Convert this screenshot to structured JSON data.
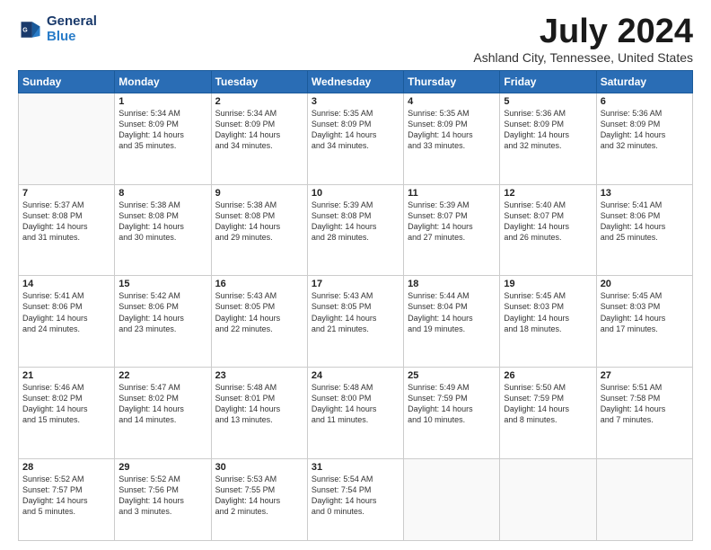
{
  "logo": {
    "line1": "General",
    "line2": "Blue"
  },
  "title": "July 2024",
  "subtitle": "Ashland City, Tennessee, United States",
  "days_of_week": [
    "Sunday",
    "Monday",
    "Tuesday",
    "Wednesday",
    "Thursday",
    "Friday",
    "Saturday"
  ],
  "weeks": [
    [
      {
        "num": "",
        "info": ""
      },
      {
        "num": "1",
        "info": "Sunrise: 5:34 AM\nSunset: 8:09 PM\nDaylight: 14 hours\nand 35 minutes."
      },
      {
        "num": "2",
        "info": "Sunrise: 5:34 AM\nSunset: 8:09 PM\nDaylight: 14 hours\nand 34 minutes."
      },
      {
        "num": "3",
        "info": "Sunrise: 5:35 AM\nSunset: 8:09 PM\nDaylight: 14 hours\nand 34 minutes."
      },
      {
        "num": "4",
        "info": "Sunrise: 5:35 AM\nSunset: 8:09 PM\nDaylight: 14 hours\nand 33 minutes."
      },
      {
        "num": "5",
        "info": "Sunrise: 5:36 AM\nSunset: 8:09 PM\nDaylight: 14 hours\nand 32 minutes."
      },
      {
        "num": "6",
        "info": "Sunrise: 5:36 AM\nSunset: 8:09 PM\nDaylight: 14 hours\nand 32 minutes."
      }
    ],
    [
      {
        "num": "7",
        "info": "Sunrise: 5:37 AM\nSunset: 8:08 PM\nDaylight: 14 hours\nand 31 minutes."
      },
      {
        "num": "8",
        "info": "Sunrise: 5:38 AM\nSunset: 8:08 PM\nDaylight: 14 hours\nand 30 minutes."
      },
      {
        "num": "9",
        "info": "Sunrise: 5:38 AM\nSunset: 8:08 PM\nDaylight: 14 hours\nand 29 minutes."
      },
      {
        "num": "10",
        "info": "Sunrise: 5:39 AM\nSunset: 8:08 PM\nDaylight: 14 hours\nand 28 minutes."
      },
      {
        "num": "11",
        "info": "Sunrise: 5:39 AM\nSunset: 8:07 PM\nDaylight: 14 hours\nand 27 minutes."
      },
      {
        "num": "12",
        "info": "Sunrise: 5:40 AM\nSunset: 8:07 PM\nDaylight: 14 hours\nand 26 minutes."
      },
      {
        "num": "13",
        "info": "Sunrise: 5:41 AM\nSunset: 8:06 PM\nDaylight: 14 hours\nand 25 minutes."
      }
    ],
    [
      {
        "num": "14",
        "info": "Sunrise: 5:41 AM\nSunset: 8:06 PM\nDaylight: 14 hours\nand 24 minutes."
      },
      {
        "num": "15",
        "info": "Sunrise: 5:42 AM\nSunset: 8:06 PM\nDaylight: 14 hours\nand 23 minutes."
      },
      {
        "num": "16",
        "info": "Sunrise: 5:43 AM\nSunset: 8:05 PM\nDaylight: 14 hours\nand 22 minutes."
      },
      {
        "num": "17",
        "info": "Sunrise: 5:43 AM\nSunset: 8:05 PM\nDaylight: 14 hours\nand 21 minutes."
      },
      {
        "num": "18",
        "info": "Sunrise: 5:44 AM\nSunset: 8:04 PM\nDaylight: 14 hours\nand 19 minutes."
      },
      {
        "num": "19",
        "info": "Sunrise: 5:45 AM\nSunset: 8:03 PM\nDaylight: 14 hours\nand 18 minutes."
      },
      {
        "num": "20",
        "info": "Sunrise: 5:45 AM\nSunset: 8:03 PM\nDaylight: 14 hours\nand 17 minutes."
      }
    ],
    [
      {
        "num": "21",
        "info": "Sunrise: 5:46 AM\nSunset: 8:02 PM\nDaylight: 14 hours\nand 15 minutes."
      },
      {
        "num": "22",
        "info": "Sunrise: 5:47 AM\nSunset: 8:02 PM\nDaylight: 14 hours\nand 14 minutes."
      },
      {
        "num": "23",
        "info": "Sunrise: 5:48 AM\nSunset: 8:01 PM\nDaylight: 14 hours\nand 13 minutes."
      },
      {
        "num": "24",
        "info": "Sunrise: 5:48 AM\nSunset: 8:00 PM\nDaylight: 14 hours\nand 11 minutes."
      },
      {
        "num": "25",
        "info": "Sunrise: 5:49 AM\nSunset: 7:59 PM\nDaylight: 14 hours\nand 10 minutes."
      },
      {
        "num": "26",
        "info": "Sunrise: 5:50 AM\nSunset: 7:59 PM\nDaylight: 14 hours\nand 8 minutes."
      },
      {
        "num": "27",
        "info": "Sunrise: 5:51 AM\nSunset: 7:58 PM\nDaylight: 14 hours\nand 7 minutes."
      }
    ],
    [
      {
        "num": "28",
        "info": "Sunrise: 5:52 AM\nSunset: 7:57 PM\nDaylight: 14 hours\nand 5 minutes."
      },
      {
        "num": "29",
        "info": "Sunrise: 5:52 AM\nSunset: 7:56 PM\nDaylight: 14 hours\nand 3 minutes."
      },
      {
        "num": "30",
        "info": "Sunrise: 5:53 AM\nSunset: 7:55 PM\nDaylight: 14 hours\nand 2 minutes."
      },
      {
        "num": "31",
        "info": "Sunrise: 5:54 AM\nSunset: 7:54 PM\nDaylight: 14 hours\nand 0 minutes."
      },
      {
        "num": "",
        "info": ""
      },
      {
        "num": "",
        "info": ""
      },
      {
        "num": "",
        "info": ""
      }
    ]
  ]
}
